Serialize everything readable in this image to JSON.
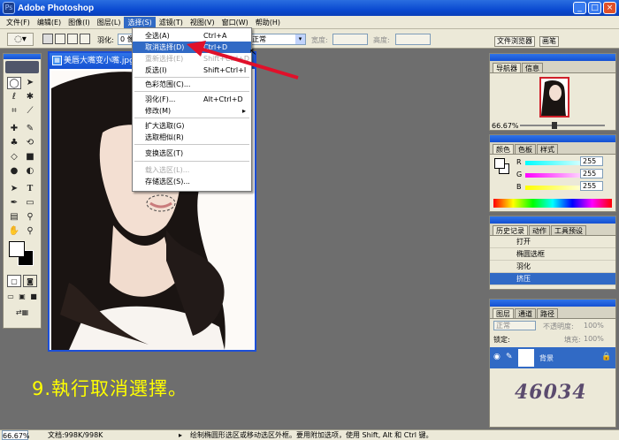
{
  "app": {
    "title": "Adobe Photoshop",
    "icon": "Ps"
  },
  "window_buttons": {
    "minimize": "_",
    "maximize": "□",
    "close": "×"
  },
  "menubar": [
    "文件(F)",
    "编辑(E)",
    "图像(I)",
    "图层(L)",
    "选择(S)",
    "滤镜(T)",
    "视图(V)",
    "窗口(W)",
    "帮助(H)"
  ],
  "options_bar": {
    "feather_label": "羽化:",
    "feather_value": "0 像",
    "style_value": "正常",
    "width_label": "宽度:",
    "height_label": "高度:",
    "file_browser_tab": "文件浏览器",
    "brushes_tab": "画笔"
  },
  "document": {
    "title": "美唇大嘴变小嘴.jpg"
  },
  "select_menu": [
    {
      "label": "全选(A)",
      "shortcut": "Ctrl+A",
      "state": "normal"
    },
    {
      "label": "取消选择(D)",
      "shortcut": "Ctrl+D",
      "state": "highlight"
    },
    {
      "label": "重新选择(E)",
      "shortcut": "Shift+Ctrl+D",
      "state": "disabled"
    },
    {
      "label": "反选(I)",
      "shortcut": "Shift+Ctrl+I",
      "state": "normal"
    },
    {
      "label": "色彩范围(C)...",
      "shortcut": "",
      "state": "normal"
    },
    {
      "label": "羽化(F)...",
      "shortcut": "Alt+Ctrl+D",
      "state": "normal"
    },
    {
      "label": "修改(M)",
      "shortcut": "",
      "state": "normal"
    },
    {
      "label": "扩大选取(G)",
      "shortcut": "",
      "state": "normal"
    },
    {
      "label": "选取相似(R)",
      "shortcut": "",
      "state": "normal"
    },
    {
      "label": "变换选区(T)",
      "shortcut": "",
      "state": "normal"
    },
    {
      "label": "载入选区(L)...",
      "shortcut": "",
      "state": "disabled"
    },
    {
      "label": "存储选区(S)...",
      "shortcut": "",
      "state": "normal"
    }
  ],
  "navigator": {
    "tabs": [
      "导航器",
      "信息"
    ],
    "zoom": "66.67%"
  },
  "color_panel": {
    "tabs": [
      "颜色",
      "色板",
      "样式"
    ],
    "channels": [
      {
        "name": "R",
        "value": "255"
      },
      {
        "name": "G",
        "value": "255"
      },
      {
        "name": "B",
        "value": "255"
      }
    ]
  },
  "history_panel": {
    "tabs": [
      "历史记录",
      "动作",
      "工具预设"
    ],
    "items": [
      "打开",
      "椭圆选框",
      "羽化",
      "挤压"
    ]
  },
  "layers_panel": {
    "tabs": [
      "图层",
      "通道",
      "路径"
    ],
    "blend_mode": "正常",
    "opacity_label": "不透明度:",
    "opacity_value": "100%",
    "lock_label": "锁定:",
    "fill_label": "填充:",
    "fill_value": "100%",
    "layer_name": "背景",
    "watermark": "46034"
  },
  "caption": "9.執行取消選擇。",
  "statusbar": {
    "zoom": "66.67%",
    "doc_info": "文档:998K/998K",
    "hint": "绘制椭圆形选区或移动选区外框。要用附加选项，使用 Shift, Alt 和 Ctrl 键。"
  },
  "colors": {
    "accent": "#316ac5",
    "caption": "#ffff00",
    "titlebar": "#0b4bd1",
    "arrow": "#e0102a"
  }
}
